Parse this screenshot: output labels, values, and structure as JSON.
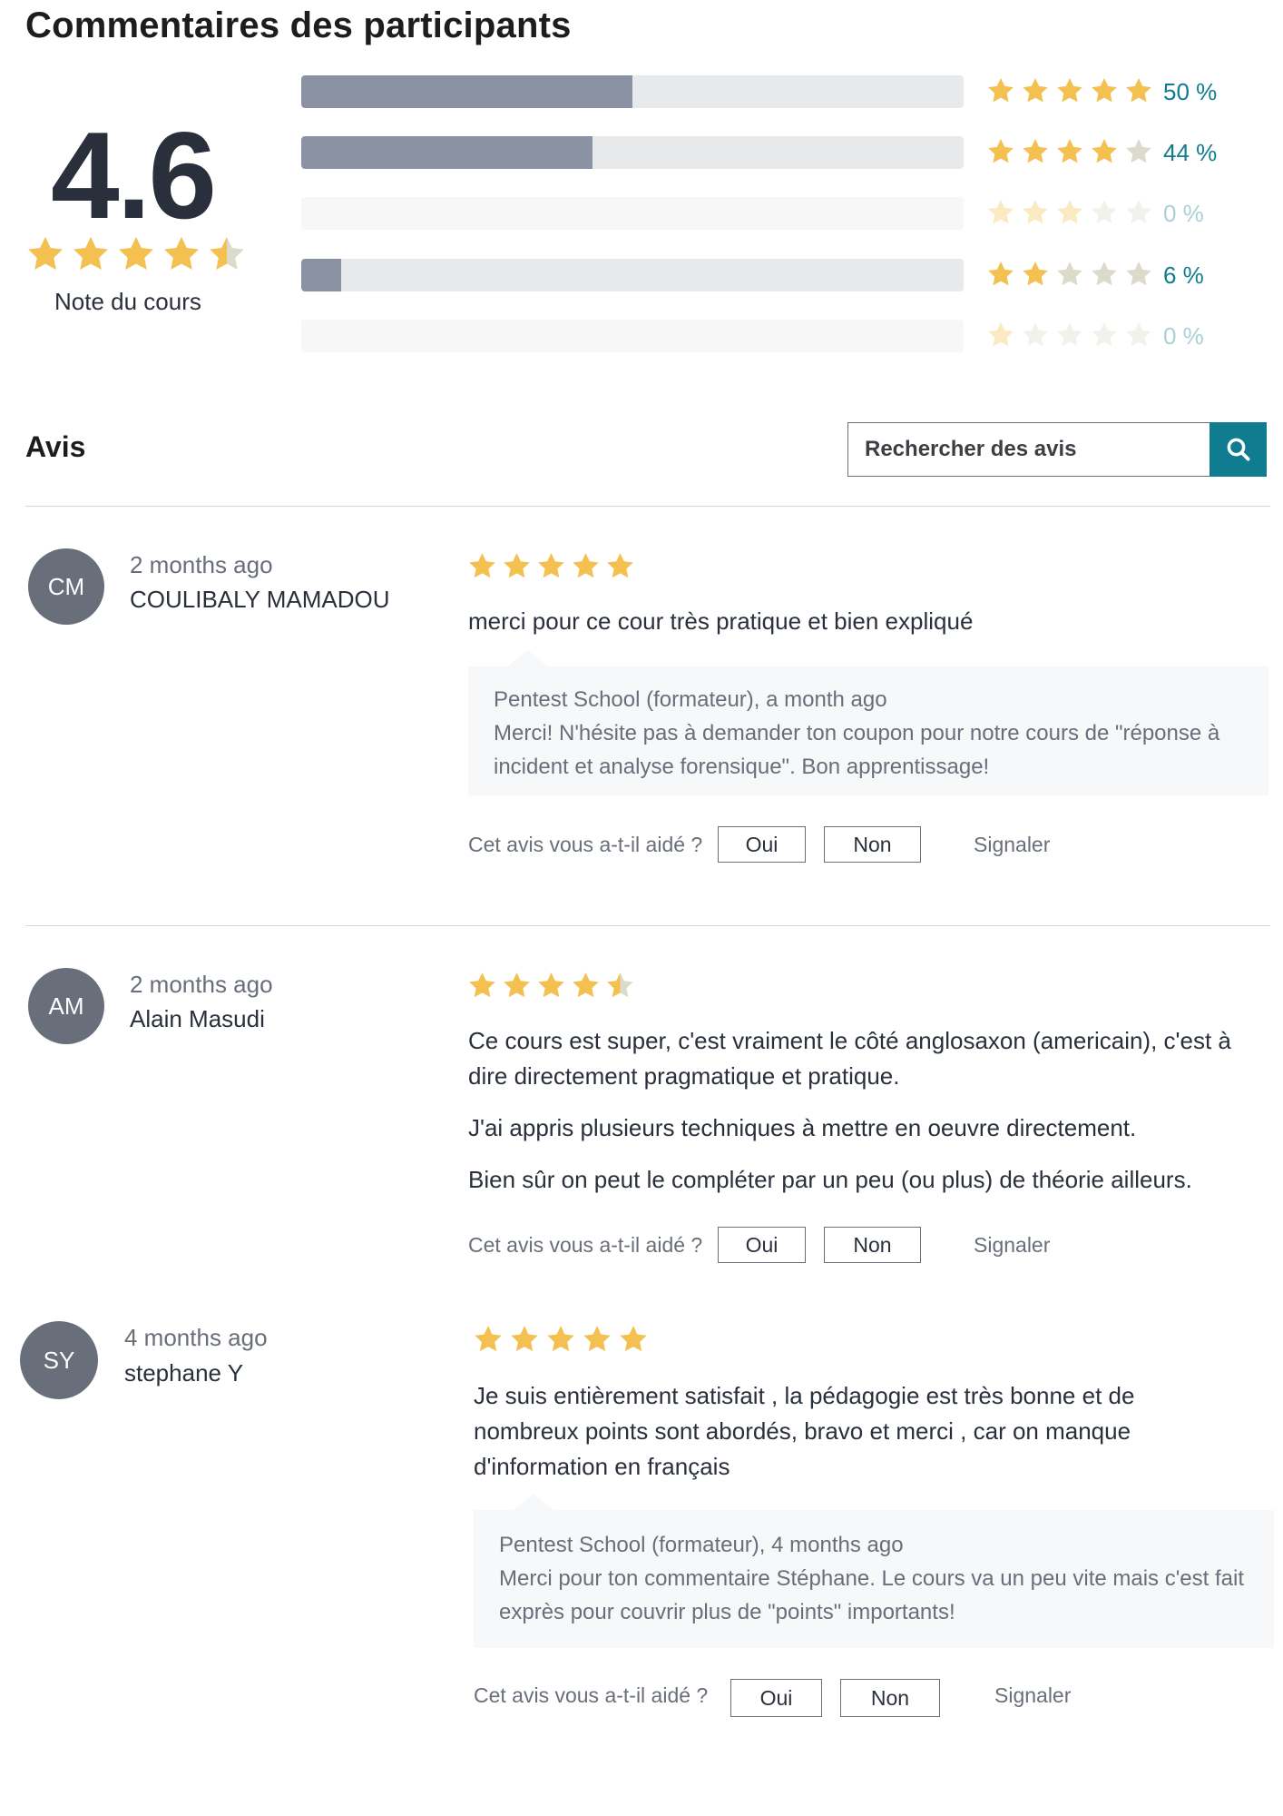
{
  "page_title": "Commentaires des participants",
  "summary": {
    "average": "4.6",
    "average_stars": 4.5,
    "label": "Note du cours"
  },
  "distribution": [
    {
      "stars": 5,
      "fraction": 0.5,
      "pct_label": "50 %"
    },
    {
      "stars": 4,
      "fraction": 0.44,
      "pct_label": "44 %"
    },
    {
      "stars": 3,
      "fraction": 0.0,
      "pct_label": "0 %"
    },
    {
      "stars": 2,
      "fraction": 0.06,
      "pct_label": "6 %"
    },
    {
      "stars": 1,
      "fraction": 0.0,
      "pct_label": "0 %"
    }
  ],
  "reviews_section": {
    "heading": "Avis",
    "search_placeholder": "Rechercher des avis",
    "search_icon": "search-icon"
  },
  "colors": {
    "star": "#f4c150",
    "star_empty": "#dcdacb",
    "accent": "#0f7c90",
    "bar_fill": "#8a92a3",
    "avatar_bg": "#686f7a"
  },
  "reviews": [
    {
      "initials": "CM",
      "date": "2 months ago",
      "author": "COULIBALY MAMADOU",
      "rating": 5,
      "paragraphs": [
        "merci pour ce cour très pratique et bien expliqué"
      ],
      "response": {
        "header": "Pentest School (formateur), a month ago",
        "text": "Merci! N'hésite pas à demander ton coupon pour notre cours de \"réponse à incident et analyse forensique\". Bon apprentissage!"
      },
      "helpful_question": "Cet avis vous a-t-il aidé ?",
      "yes_label": "Oui",
      "no_label": "Non",
      "report_label": "Signaler"
    },
    {
      "initials": "AM",
      "date": "2 months ago",
      "author": "Alain Masudi",
      "rating": 4.5,
      "paragraphs": [
        "Ce cours est super, c'est vraiment le côté anglosaxon (americain), c'est à dire directement pragmatique et pratique.",
        "J'ai appris plusieurs techniques à mettre en oeuvre directement.",
        "Bien sûr on peut le compléter par un peu (ou plus) de théorie ailleurs."
      ],
      "helpful_question": "Cet avis vous a-t-il aidé ?",
      "yes_label": "Oui",
      "no_label": "Non",
      "report_label": "Signaler"
    },
    {
      "initials": "SY",
      "date": "4 months ago",
      "author": "stephane Y",
      "rating": 5,
      "paragraphs": [
        "Je suis entièrement satisfait , la pédagogie est très bonne et de nombreux points sont abordés, bravo et merci , car on manque d'information en français"
      ],
      "response": {
        "header": "Pentest School (formateur), 4 months ago",
        "text": "Merci pour ton commentaire Stéphane. Le cours va un peu vite mais c'est fait exprès pour couvrir plus de \"points\" importants!"
      },
      "helpful_question": "Cet avis vous a-t-il aidé ?",
      "yes_label": "Oui",
      "no_label": "Non",
      "report_label": "Signaler"
    }
  ]
}
